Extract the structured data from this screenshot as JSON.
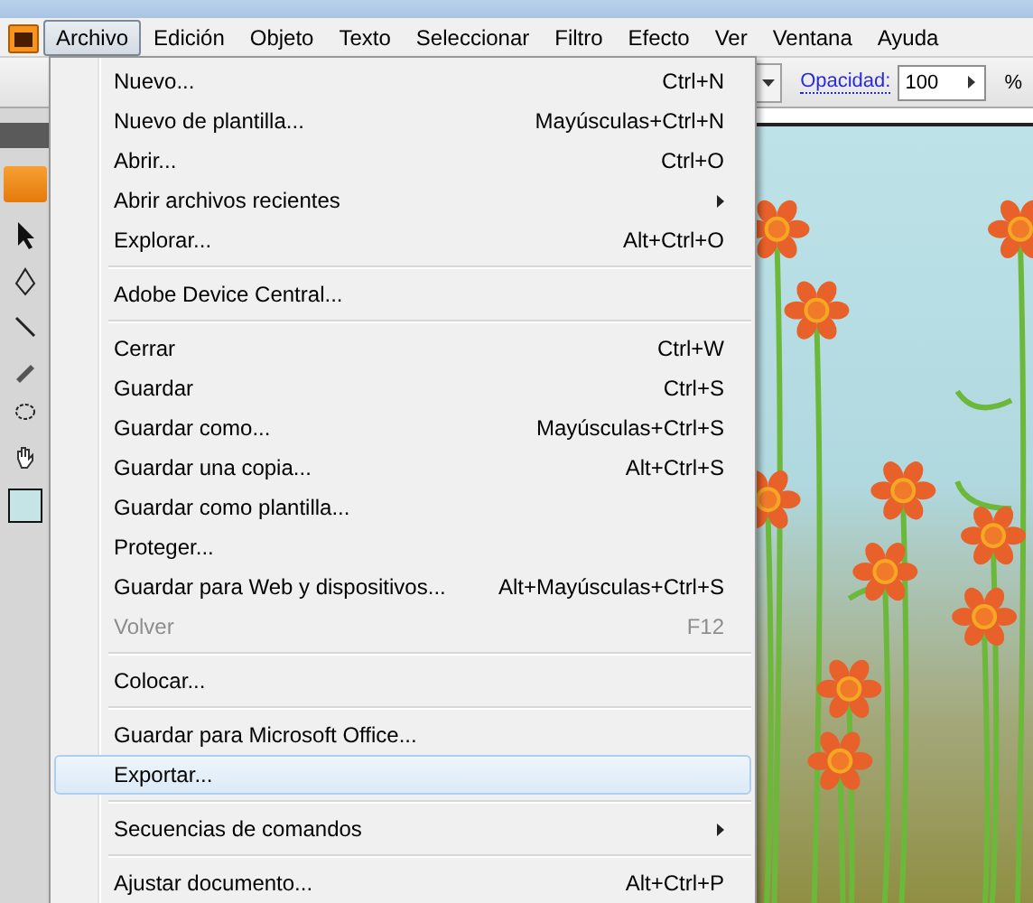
{
  "menu_bar": [
    {
      "label": "Archivo",
      "selected": true
    },
    {
      "label": "Edición",
      "selected": false
    },
    {
      "label": "Objeto",
      "selected": false
    },
    {
      "label": "Texto",
      "selected": false
    },
    {
      "label": "Seleccionar",
      "selected": false
    },
    {
      "label": "Filtro",
      "selected": false
    },
    {
      "label": "Efecto",
      "selected": false
    },
    {
      "label": "Ver",
      "selected": false
    },
    {
      "label": "Ventana",
      "selected": false
    },
    {
      "label": "Ayuda",
      "selected": false
    }
  ],
  "control_bar": {
    "opacity_label": "Opacidad:",
    "opacity_value": "100",
    "unit": "%"
  },
  "file_menu": [
    {
      "kind": "item",
      "label": "Nuevo...",
      "shortcut": "Ctrl+N",
      "submenu": false,
      "disabled": false,
      "selected": false
    },
    {
      "kind": "item",
      "label": "Nuevo de plantilla...",
      "shortcut": "Mayúsculas+Ctrl+N",
      "submenu": false,
      "disabled": false,
      "selected": false
    },
    {
      "kind": "item",
      "label": "Abrir...",
      "shortcut": "Ctrl+O",
      "submenu": false,
      "disabled": false,
      "selected": false
    },
    {
      "kind": "item",
      "label": "Abrir archivos recientes",
      "submenu": true,
      "disabled": false,
      "selected": false
    },
    {
      "kind": "item",
      "label": "Explorar...",
      "shortcut": "Alt+Ctrl+O",
      "submenu": false,
      "disabled": false,
      "selected": false
    },
    {
      "kind": "separator"
    },
    {
      "kind": "item",
      "label": "Adobe Device Central...",
      "submenu": false,
      "disabled": false,
      "selected": false
    },
    {
      "kind": "separator"
    },
    {
      "kind": "item",
      "label": "Cerrar",
      "shortcut": "Ctrl+W",
      "submenu": false,
      "disabled": false,
      "selected": false
    },
    {
      "kind": "item",
      "label": "Guardar",
      "shortcut": "Ctrl+S",
      "submenu": false,
      "disabled": false,
      "selected": false
    },
    {
      "kind": "item",
      "label": "Guardar como...",
      "shortcut": "Mayúsculas+Ctrl+S",
      "submenu": false,
      "disabled": false,
      "selected": false
    },
    {
      "kind": "item",
      "label": "Guardar una copia...",
      "shortcut": "Alt+Ctrl+S",
      "submenu": false,
      "disabled": false,
      "selected": false
    },
    {
      "kind": "item",
      "label": "Guardar como plantilla...",
      "submenu": false,
      "disabled": false,
      "selected": false
    },
    {
      "kind": "item",
      "label": "Proteger...",
      "submenu": false,
      "disabled": false,
      "selected": false
    },
    {
      "kind": "item",
      "label": "Guardar para Web y dispositivos...",
      "shortcut": "Alt+Mayúsculas+Ctrl+S",
      "submenu": false,
      "disabled": false,
      "selected": false
    },
    {
      "kind": "item",
      "label": "Volver",
      "shortcut": "F12",
      "submenu": false,
      "disabled": true,
      "selected": false
    },
    {
      "kind": "separator"
    },
    {
      "kind": "item",
      "label": "Colocar...",
      "submenu": false,
      "disabled": false,
      "selected": false
    },
    {
      "kind": "separator"
    },
    {
      "kind": "item",
      "label": "Guardar para Microsoft Office...",
      "submenu": false,
      "disabled": false,
      "selected": false
    },
    {
      "kind": "item",
      "label": "Exportar...",
      "submenu": false,
      "disabled": false,
      "selected": true
    },
    {
      "kind": "separator"
    },
    {
      "kind": "item",
      "label": "Secuencias de comandos",
      "submenu": true,
      "disabled": false,
      "selected": false
    },
    {
      "kind": "separator"
    },
    {
      "kind": "item",
      "label": "Ajustar documento...",
      "shortcut": "Alt+Ctrl+P",
      "submenu": false,
      "disabled": false,
      "selected": false
    }
  ]
}
